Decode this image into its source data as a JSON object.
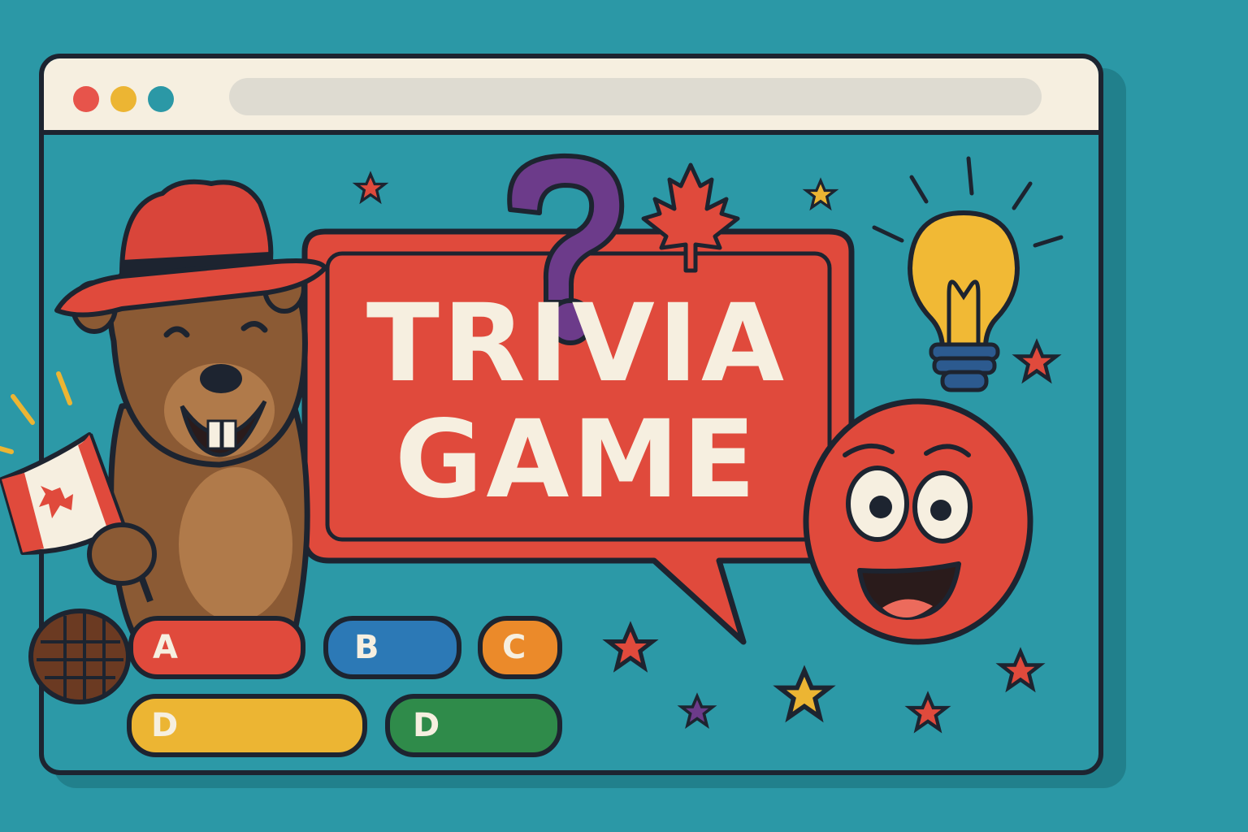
{
  "game": {
    "title_line1": "TRIVIA",
    "title_line2": "GAME",
    "answers": [
      {
        "letter": "A",
        "color": "#e04a3c"
      },
      {
        "letter": "B",
        "color": "#2c79b6"
      },
      {
        "letter": "C",
        "color": "#eb8a2a"
      },
      {
        "letter": "D",
        "color": "#ecb533"
      },
      {
        "letter": "D",
        "color": "#2f8b4a"
      }
    ]
  },
  "colors": {
    "background": "#2b98a6",
    "titlebar": "#f6efe0",
    "speech_bubble": "#e04a3c",
    "question_mark": "#6c3b8a",
    "outline": "#1d2430"
  },
  "icons": [
    "beaver-mascot",
    "mountie-hat-icon",
    "canada-flag-icon",
    "question-mark-icon",
    "maple-leaf-icon",
    "lightbulb-icon",
    "smiley-face-icon",
    "star-icon"
  ]
}
